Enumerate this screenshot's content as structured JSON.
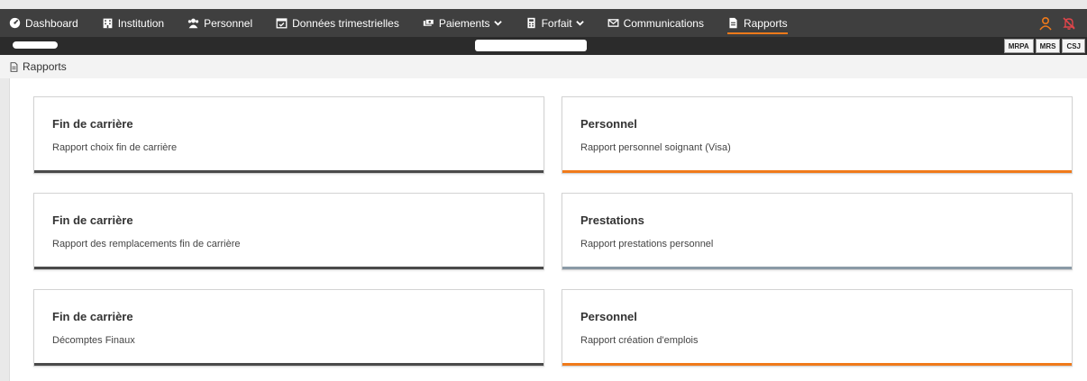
{
  "nav": {
    "items": [
      {
        "label": "Dashboard",
        "icon": "dashboard-icon"
      },
      {
        "label": "Institution",
        "icon": "building-icon"
      },
      {
        "label": "Personnel",
        "icon": "users-icon"
      },
      {
        "label": "Données trimestrielles",
        "icon": "calendar-check-icon"
      },
      {
        "label": "Paiements",
        "icon": "money-icon",
        "dropdown": true
      },
      {
        "label": "Forfait",
        "icon": "calculator-icon",
        "dropdown": true
      },
      {
        "label": "Communications",
        "icon": "envelope-icon"
      },
      {
        "label": "Rapports",
        "icon": "report-icon",
        "active": true
      }
    ],
    "accent_color": "#f07a1a",
    "background_color": "#3f3f3f"
  },
  "subbar": {
    "tags": [
      "MRPA",
      "MRS",
      "CSJ"
    ]
  },
  "breadcrumb": {
    "label": "Rapports"
  },
  "cards": [
    {
      "title": "Fin de carrière",
      "description": "Rapport choix fin de carrière",
      "bar_color": "#4a4a4a"
    },
    {
      "title": "Personnel",
      "description": "Rapport personnel soignant (Visa)",
      "bar_color": "#f07a1a"
    },
    {
      "title": "Fin de carrière",
      "description": "Rapport des remplacements fin de carrière",
      "bar_color": "#4a4a4a"
    },
    {
      "title": "Prestations",
      "description": "Rapport prestations personnel",
      "bar_color": "#8a9aa6"
    },
    {
      "title": "Fin de carrière",
      "description": "Décomptes Finaux",
      "bar_color": "#4a4a4a"
    },
    {
      "title": "Personnel",
      "description": "Rapport création d'emplois",
      "bar_color": "#f07a1a"
    }
  ]
}
